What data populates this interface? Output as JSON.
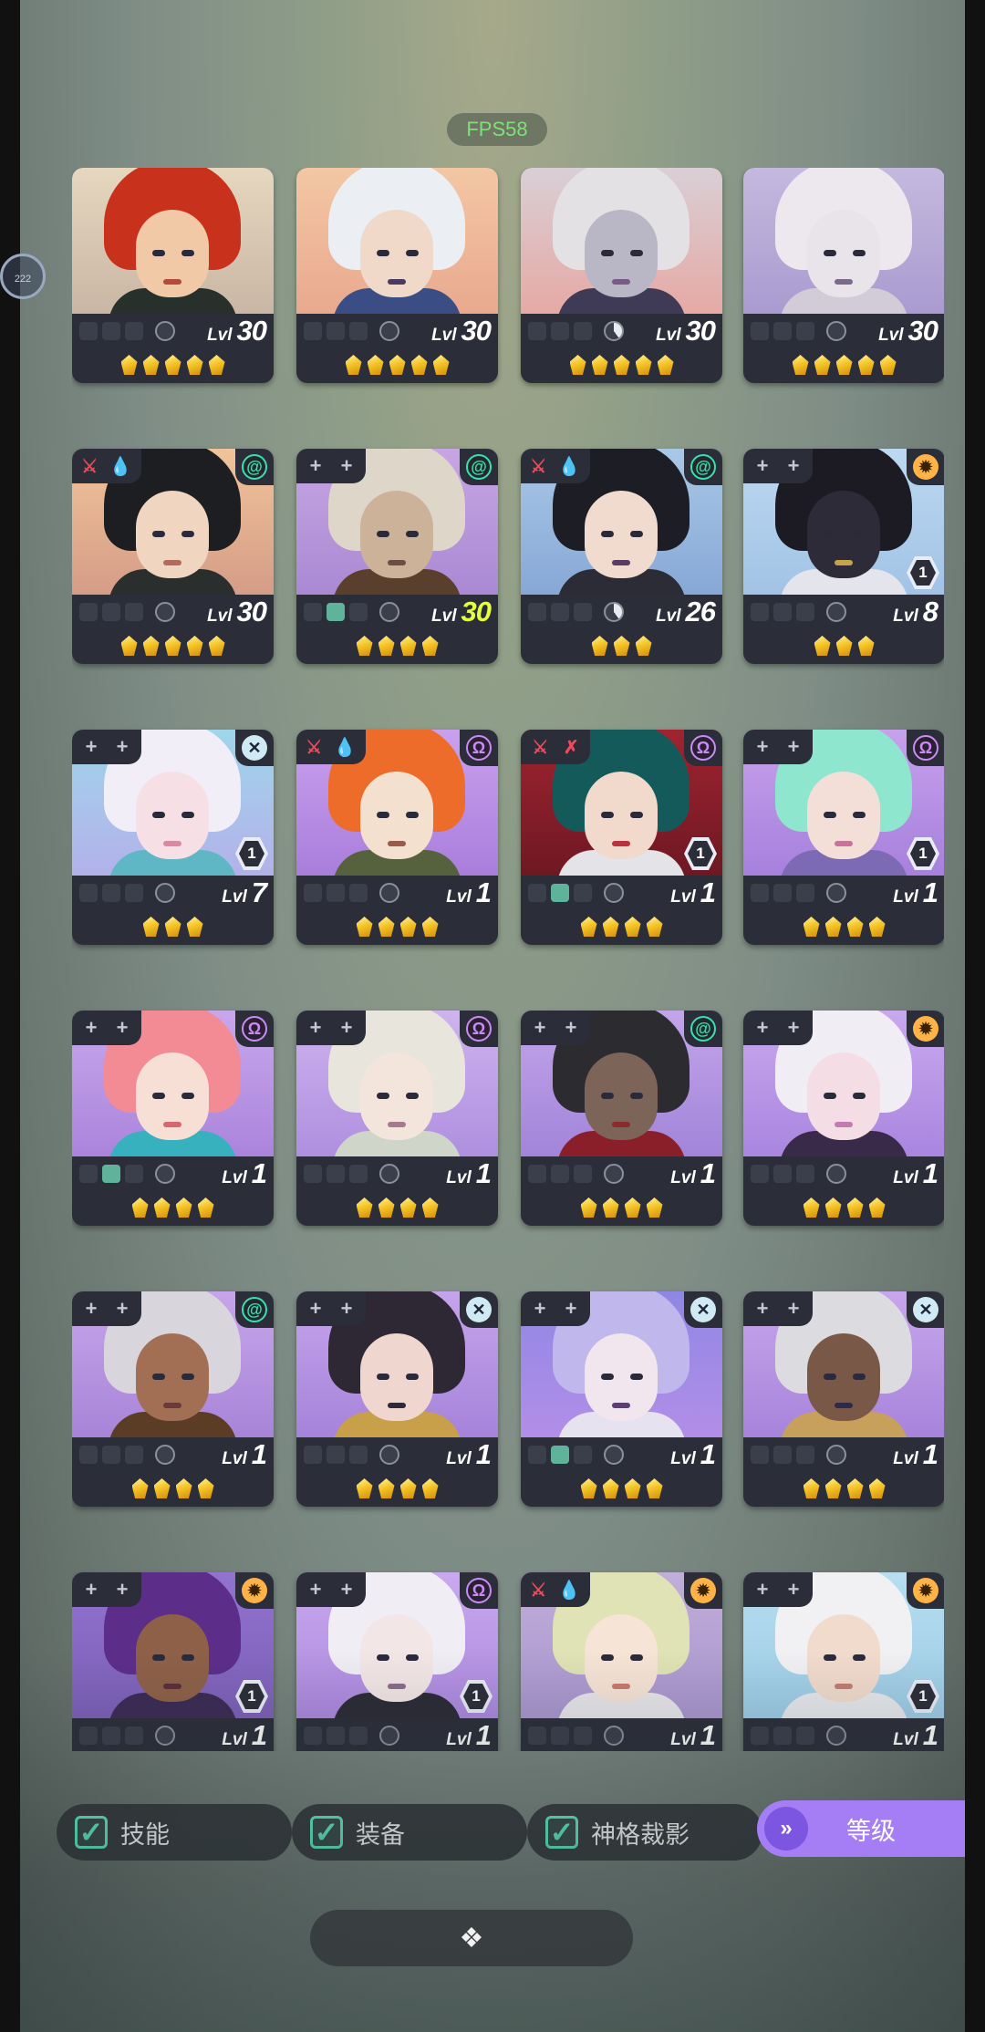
{
  "fps": "FPS58",
  "floating_ball": "222",
  "heroes": [
    {
      "badges": [],
      "faction": null,
      "tier": null,
      "equip": [
        false,
        false,
        false
      ],
      "pie": "empty",
      "level": "30",
      "level_color": "white",
      "stars": 5,
      "bg": [
        "#e6d7bf",
        "#c9b6a4"
      ],
      "hair": "#c8321c",
      "skin": "#f2c9a7",
      "lips": "#b24b3a",
      "body": "#27302a"
    },
    {
      "badges": [],
      "faction": null,
      "tier": null,
      "equip": [
        false,
        false,
        false
      ],
      "pie": "empty",
      "level": "30",
      "level_color": "white",
      "stars": 5,
      "bg": [
        "#f3c7a4",
        "#e9a98e"
      ],
      "hair": "#ebeef2",
      "skin": "#f0d9c9",
      "lips": "#4b3a5e",
      "body": "#3a4e85"
    },
    {
      "badges": [],
      "faction": null,
      "tier": null,
      "equip": [
        false,
        false,
        false
      ],
      "pie": "half",
      "level": "30",
      "level_color": "white",
      "stars": 5,
      "bg": [
        "#d9cfd6",
        "#e6a9a4"
      ],
      "hair": "#e4e1e4",
      "skin": "#b9b6c5",
      "lips": "#7a5a86",
      "body": "#3f3a55"
    },
    {
      "badges": [],
      "faction": null,
      "tier": null,
      "equip": [
        false,
        false,
        false
      ],
      "pie": "empty",
      "level": "30",
      "level_color": "white",
      "stars": 5,
      "bg": [
        "#c4b9de",
        "#a99bd0"
      ],
      "hair": "#ece8ee",
      "skin": "#e8e4ea",
      "lips": "#7b6a8a",
      "body": "#d2cbd8"
    },
    {
      "badges": [
        "sword",
        "drop"
      ],
      "faction": "spiral",
      "tier": null,
      "equip": [
        false,
        false,
        false
      ],
      "pie": "empty",
      "level": "30",
      "level_color": "white",
      "stars": 5,
      "bg": [
        "#f0c49a",
        "#d59c87"
      ],
      "hair": "#1d1e22",
      "skin": "#f0d6c0",
      "lips": "#b56a5e",
      "body": "#2a2f2d"
    },
    {
      "badges": [
        "plus",
        "plus"
      ],
      "faction": "spiral",
      "tier": null,
      "equip": [
        false,
        true,
        false
      ],
      "pie": "empty",
      "level": "30",
      "level_color": "yellow",
      "stars": 4,
      "bg": [
        "#c7a6e3",
        "#a989d3"
      ],
      "hair": "#ded6c9",
      "skin": "#cdb29a",
      "lips": "#6d4e43",
      "body": "#5b3f2d"
    },
    {
      "badges": [
        "sword",
        "drop"
      ],
      "faction": "spiral",
      "tier": null,
      "equip": [
        false,
        false,
        false
      ],
      "pie": "half",
      "level": "26",
      "level_color": "white",
      "stars": 3,
      "bg": [
        "#a8c8e6",
        "#87a8d6"
      ],
      "hair": "#1c1d25",
      "skin": "#f1dbcf",
      "lips": "#5a3b65",
      "body": "#2b2c36"
    },
    {
      "badges": [
        "plus",
        "plus"
      ],
      "faction": "gear",
      "tier": "1",
      "equip": [
        false,
        false,
        false
      ],
      "pie": "empty",
      "level": "8",
      "level_color": "white",
      "stars": 3,
      "bg": [
        "#bcd9f0",
        "#a2c3e6"
      ],
      "hair": "#1c1b24",
      "skin": "#2d2b38",
      "lips": "#c4a34a",
      "body": "#e4e5ec"
    },
    {
      "badges": [
        "plus",
        "plus"
      ],
      "faction": "cross",
      "tier": "1",
      "equip": [
        false,
        false,
        false
      ],
      "pie": "empty",
      "level": "7",
      "level_color": "white",
      "stars": 3,
      "bg": [
        "#9fd6ea",
        "#b3b1ea"
      ],
      "hair": "#f1eef8",
      "skin": "#f7e0e5",
      "lips": "#d88aa0",
      "body": "#5fb7c6"
    },
    {
      "badges": [
        "sword",
        "drop"
      ],
      "faction": "omega",
      "tier": null,
      "equip": [
        false,
        false,
        false
      ],
      "pie": "empty",
      "level": "1",
      "level_color": "white",
      "stars": 4,
      "bg": [
        "#caa0ee",
        "#a97edb"
      ],
      "hair": "#ee6c2a",
      "skin": "#f3e0cf",
      "lips": "#9b5b4b",
      "body": "#56613d"
    },
    {
      "badges": [
        "sword",
        "crossed"
      ],
      "faction": "omega",
      "tier": "1",
      "equip": [
        false,
        true,
        false
      ],
      "pie": "empty",
      "level": "1",
      "level_color": "white",
      "stars": 4,
      "bg": [
        "#a02430",
        "#6e1823"
      ],
      "hair": "#155a5b",
      "skin": "#f1d9cc",
      "lips": "#b9323e",
      "body": "#e4e3e8"
    },
    {
      "badges": [
        "plus",
        "plus"
      ],
      "faction": "omega",
      "tier": "1",
      "equip": [
        false,
        false,
        false
      ],
      "pie": "empty",
      "level": "1",
      "level_color": "white",
      "stars": 4,
      "bg": [
        "#c8a1ec",
        "#a680dc"
      ],
      "hair": "#8ee6cf",
      "skin": "#f4dfd8",
      "lips": "#c8739a",
      "body": "#7c6ab5"
    },
    {
      "badges": [
        "plus",
        "plus"
      ],
      "faction": "omega",
      "tier": null,
      "equip": [
        false,
        true,
        false
      ],
      "pie": "empty",
      "level": "1",
      "level_color": "white",
      "stars": 4,
      "bg": [
        "#c9a7ec",
        "#aa84dc"
      ],
      "hair": "#f28b93",
      "skin": "#f7dfd6",
      "lips": "#d7666f",
      "body": "#37b1be"
    },
    {
      "badges": [
        "plus",
        "plus"
      ],
      "faction": "omega",
      "tier": null,
      "equip": [
        false,
        false,
        false
      ],
      "pie": "empty",
      "level": "1",
      "level_color": "white",
      "stars": 4,
      "bg": [
        "#cfb3ee",
        "#ae8fe0"
      ],
      "hair": "#e8e5dc",
      "skin": "#f3e4dc",
      "lips": "#a57a8e",
      "body": "#cfd5c9"
    },
    {
      "badges": [
        "plus",
        "plus"
      ],
      "faction": "spiral",
      "tier": null,
      "equip": [
        false,
        false,
        false
      ],
      "pie": "empty",
      "level": "1",
      "level_color": "white",
      "stars": 4,
      "bg": [
        "#c2a5ea",
        "#a284da"
      ],
      "hair": "#2b2b30",
      "skin": "#7c6459",
      "lips": "#8c2b2b",
      "body": "#8a1f2a"
    },
    {
      "badges": [
        "plus",
        "plus"
      ],
      "faction": "gear",
      "tier": null,
      "equip": [
        false,
        false,
        false
      ],
      "pie": "empty",
      "level": "1",
      "level_color": "white",
      "stars": 4,
      "bg": [
        "#c9a8ef",
        "#a986df"
      ],
      "hair": "#f1edf5",
      "skin": "#f4dde5",
      "lips": "#c57ab3",
      "body": "#3a2a4a"
    },
    {
      "badges": [
        "plus",
        "plus"
      ],
      "faction": "spiral",
      "tier": null,
      "equip": [
        false,
        false,
        false
      ],
      "pie": "empty",
      "level": "1",
      "level_color": "white",
      "stars": 4,
      "bg": [
        "#c7a5ea",
        "#a884d8"
      ],
      "hair": "#d8d5dc",
      "skin": "#a26f55",
      "lips": "#6a3b3a",
      "body": "#5b3d26"
    },
    {
      "badges": [
        "plus",
        "plus"
      ],
      "faction": "cross",
      "tier": null,
      "equip": [
        false,
        false,
        false
      ],
      "pie": "empty",
      "level": "1",
      "level_color": "white",
      "stars": 4,
      "bg": [
        "#c6a4eb",
        "#a583da"
      ],
      "hair": "#2d2833",
      "skin": "#efd7cf",
      "lips": "#2e2a3a",
      "body": "#c8a04a"
    },
    {
      "badges": [
        "plus",
        "plus"
      ],
      "faction": "cross",
      "tier": null,
      "equip": [
        false,
        true,
        false
      ],
      "pie": "empty",
      "level": "1",
      "level_color": "white",
      "stars": 4,
      "bg": [
        "#8f87e4",
        "#b28ee8"
      ],
      "hair": "#c0b7ec",
      "skin": "#f1e5ee",
      "lips": "#5c3e74",
      "body": "#e6e2ef"
    },
    {
      "badges": [
        "plus",
        "plus"
      ],
      "faction": "cross",
      "tier": null,
      "equip": [
        false,
        false,
        false
      ],
      "pie": "empty",
      "level": "1",
      "level_color": "white",
      "stars": 4,
      "bg": [
        "#c7a6ec",
        "#a784db"
      ],
      "hair": "#dcdbe0",
      "skin": "#7a5848",
      "lips": "#2f2a4a",
      "body": "#c7a05b"
    },
    {
      "badges": [
        "plus",
        "plus"
      ],
      "faction": "gear",
      "tier": "1",
      "equip": [
        false,
        false,
        false
      ],
      "pie": "empty",
      "level": "1",
      "level_color": "white",
      "stars": 0,
      "bg": [
        "#9273d0",
        "#7c5fb8"
      ],
      "hair": "#5c2e8a",
      "skin": "#8e6048",
      "lips": "#5a2e3a",
      "body": "#3b2a55"
    },
    {
      "badges": [
        "plus",
        "plus"
      ],
      "faction": "omega",
      "tier": "1",
      "equip": [
        false,
        false,
        false
      ],
      "pie": "empty",
      "level": "1",
      "level_color": "white",
      "stars": 0,
      "bg": [
        "#c9a9ee",
        "#ab88df"
      ],
      "hair": "#f0eef4",
      "skin": "#f3e6e6",
      "lips": "#8a6e8a",
      "body": "#2b2a36"
    },
    {
      "badges": [
        "sword",
        "drop"
      ],
      "faction": "gear",
      "tier": null,
      "equip": [
        false,
        false,
        false
      ],
      "pie": "empty",
      "level": "1",
      "level_color": "white",
      "stars": 0,
      "bg": [
        "#c1aed9",
        "#a995cf"
      ],
      "hair": "#dfe3b5",
      "skin": "#f6e4d6",
      "lips": "#c97a6e",
      "body": "#e8e6ea"
    },
    {
      "badges": [
        "plus",
        "plus"
      ],
      "faction": "gear",
      "tier": "1",
      "equip": [
        false,
        false,
        false
      ],
      "pie": "empty",
      "level": "1",
      "level_color": "white",
      "stars": 0,
      "bg": [
        "#b7def0",
        "#9ccbe6"
      ],
      "hair": "#f1f1f3",
      "skin": "#f1dbcc",
      "lips": "#c07e70",
      "body": "#e6e8ec"
    }
  ],
  "level_prefix": "Lvl",
  "filters": [
    {
      "label": "技能",
      "checked": true
    },
    {
      "label": "装备",
      "checked": true
    },
    {
      "label": "神格裁影",
      "checked": true
    }
  ],
  "sort_button": {
    "label": "等级",
    "icon": "double-chevron-down-icon"
  },
  "bottom_button": {
    "icon": "diamonds-cluster-icon",
    "glyph": "❖"
  }
}
